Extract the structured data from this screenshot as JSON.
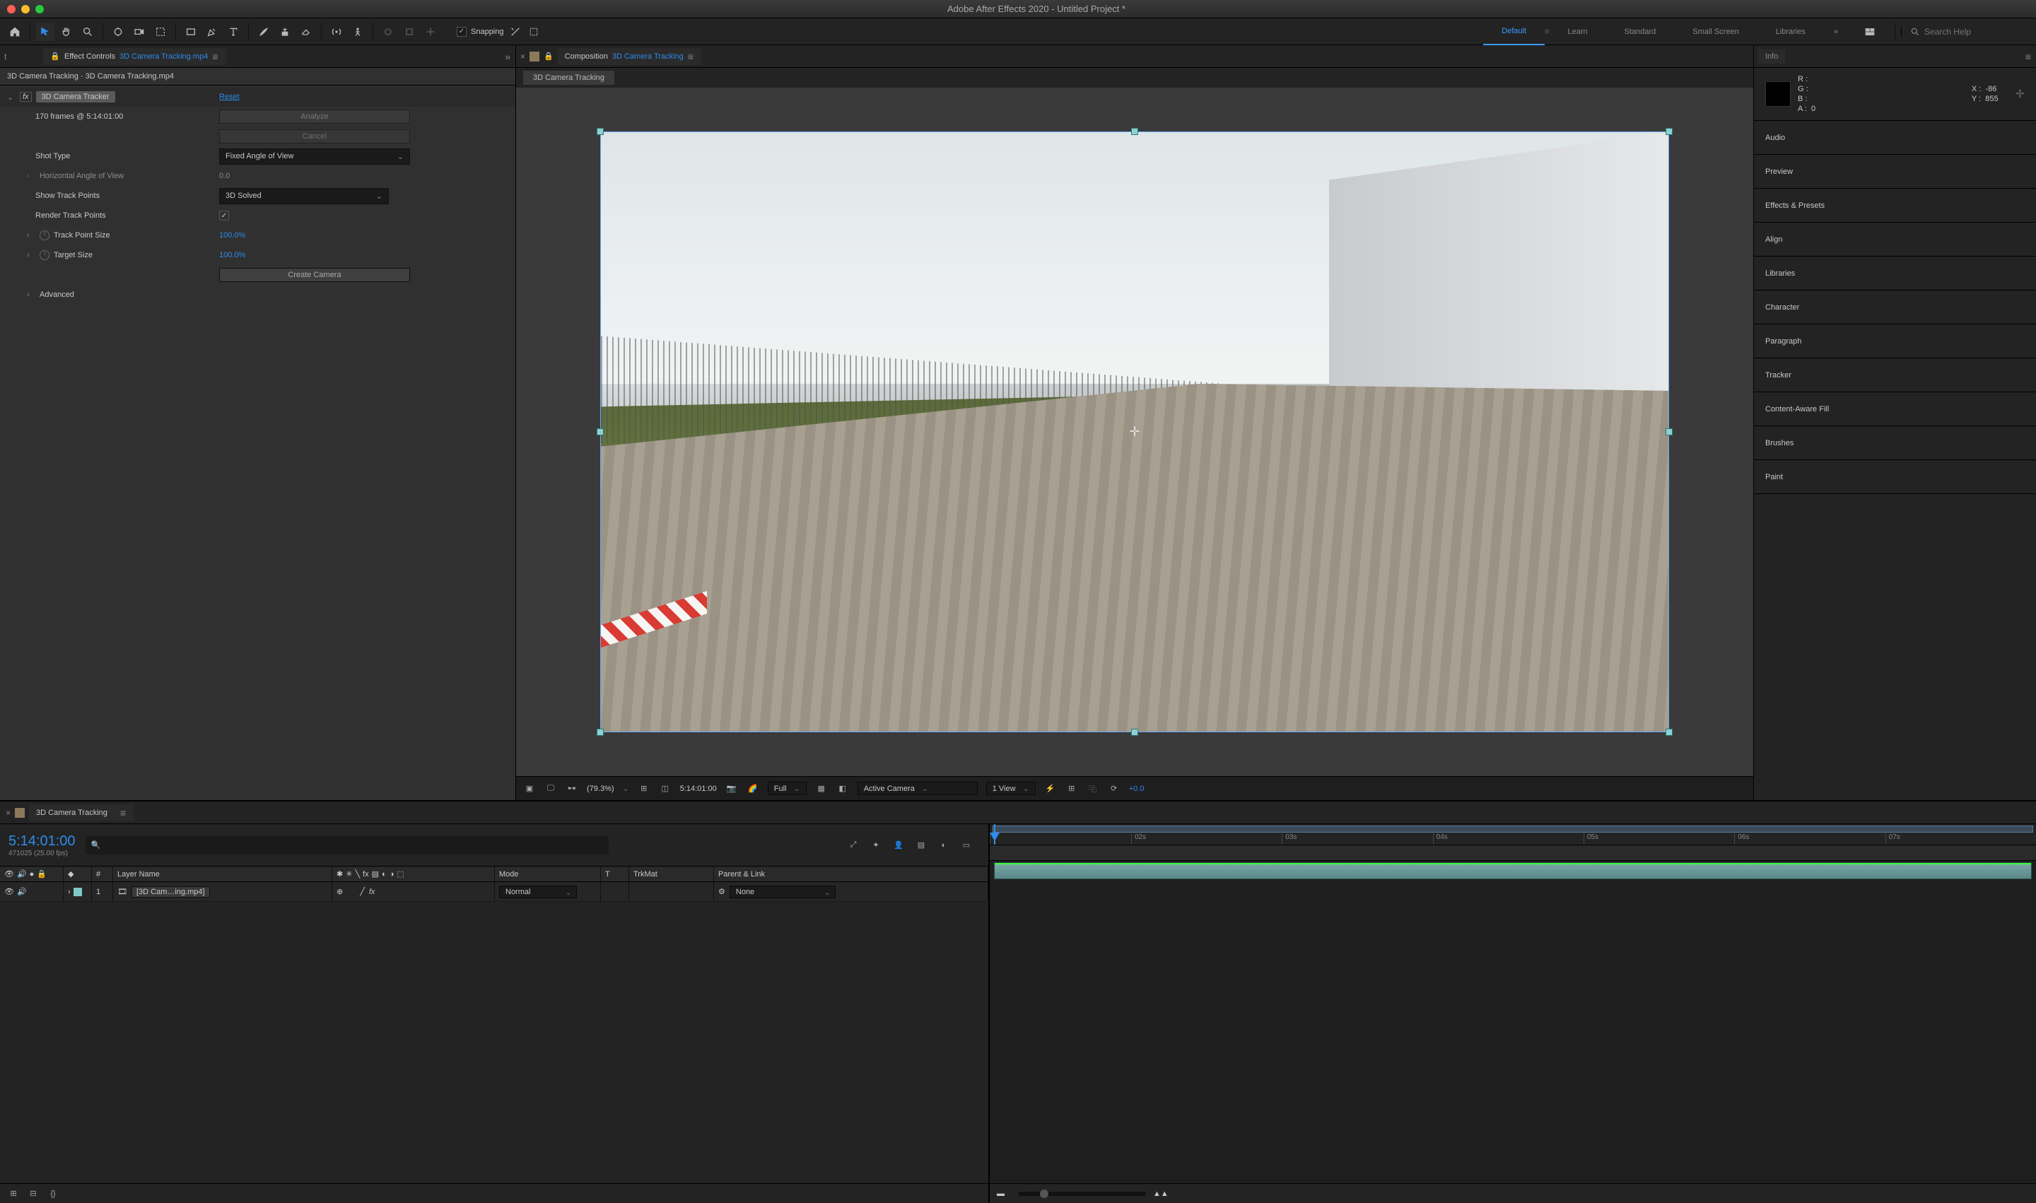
{
  "app": {
    "title": "Adobe After Effects 2020 - Untitled Project *"
  },
  "toolbar": {
    "snapping_label": "Snapping",
    "workspaces": [
      "Default",
      "Learn",
      "Standard",
      "Small Screen",
      "Libraries"
    ],
    "active_workspace": "Default",
    "search_placeholder": "Search Help"
  },
  "effect_controls": {
    "tab_prefix": "Effect Controls",
    "tab_link": "3D Camera Tracking.mp4",
    "breadcrumb": "3D Camera Tracking · 3D Camera Tracking.mp4",
    "effect_name": "3D Camera Tracker",
    "reset": "Reset",
    "frames_info": "170 frames @ 5:14:01:00",
    "analyze": "Analyze",
    "cancel": "Cancel",
    "rows": {
      "shot_type_label": "Shot Type",
      "shot_type_value": "Fixed Angle of View",
      "hangle_label": "Horizontal Angle of View",
      "hangle_value": "0.0",
      "show_tp_label": "Show Track Points",
      "show_tp_value": "3D Solved",
      "render_tp_label": "Render Track Points",
      "tp_size_label": "Track Point Size",
      "tp_size_value": "100.0%",
      "target_size_label": "Target Size",
      "target_size_value": "100.0%",
      "create_camera": "Create Camera",
      "advanced": "Advanced"
    }
  },
  "composition": {
    "tab_prefix": "Composition",
    "tab_link": "3D Camera Tracking",
    "sub_tab": "3D Camera Tracking",
    "viewer_bar": {
      "zoom": "(79.3%)",
      "timecode": "5:14:01:00",
      "resolution": "Full",
      "camera": "Active Camera",
      "views": "1 View",
      "exposure": "+0.0"
    }
  },
  "info": {
    "panel_title": "Info",
    "R": "R :",
    "G": "G :",
    "B": "B :",
    "A": "A :",
    "A_val": "0",
    "X": "X :",
    "X_val": "-86",
    "Y": "Y :",
    "Y_val": "855"
  },
  "right_panels": [
    "Audio",
    "Preview",
    "Effects & Presets",
    "Align",
    "Libraries",
    "Character",
    "Paragraph",
    "Tracker",
    "Content-Aware Fill",
    "Brushes",
    "Paint"
  ],
  "timeline": {
    "tab": "3D Camera Tracking",
    "timecode": "5:14:01:00",
    "timecode_sub": "471025 (25.00 fps)",
    "columns": {
      "num": "#",
      "layer_name": "Layer Name",
      "mode": "Mode",
      "t": "T",
      "trkmat": "TrkMat",
      "parent": "Parent & Link"
    },
    "layers": [
      {
        "index": "1",
        "name": "[3D Cam…ing.mp4]",
        "mode": "Normal",
        "parent": "None"
      }
    ],
    "ruler": [
      "02s",
      "03s",
      "04s",
      "05s",
      "06s",
      "07s"
    ]
  }
}
